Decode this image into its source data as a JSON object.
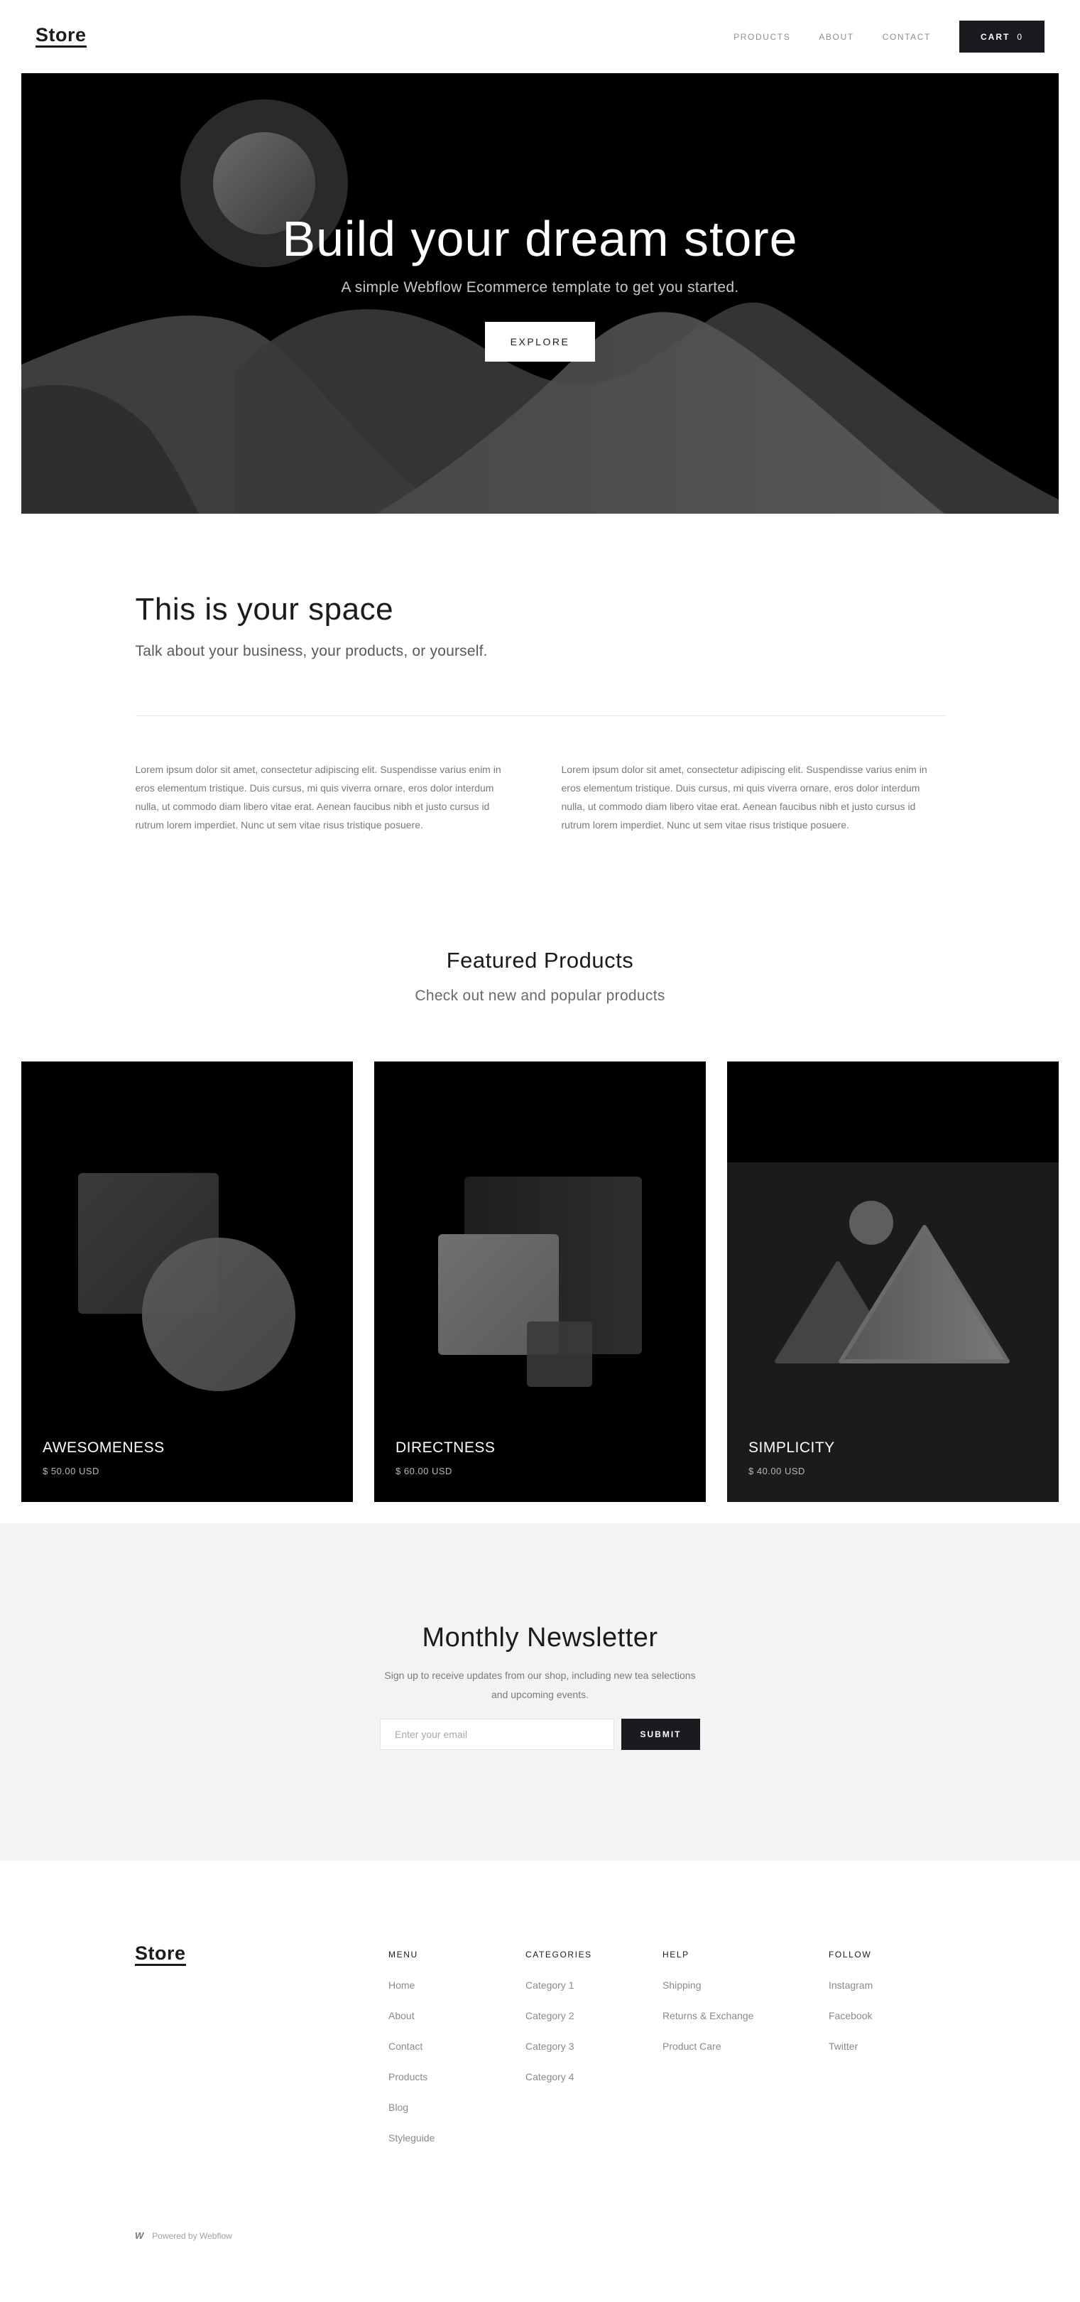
{
  "nav": {
    "brand": "Store",
    "links": [
      "PRODUCTS",
      "ABOUT",
      "CONTACT"
    ],
    "cart_label": "CART",
    "cart_count": "0"
  },
  "hero": {
    "title": "Build your dream store",
    "subtitle": "A simple Webflow Ecommerce template to get you started.",
    "button": "EXPLORE"
  },
  "space": {
    "title": "This is your space",
    "subtitle": "Talk about your business, your products, or yourself.",
    "paragraphs": [
      "Lorem ipsum dolor sit amet, consectetur adipiscing elit. Suspendisse varius enim in eros elementum tristique. Duis cursus, mi quis viverra ornare, eros dolor interdum nulla, ut commodo diam libero vitae erat. Aenean faucibus nibh et justo cursus id rutrum lorem imperdiet. Nunc ut sem vitae risus tristique posuere.",
      "Lorem ipsum dolor sit amet, consectetur adipiscing elit. Suspendisse varius enim in eros elementum tristique. Duis cursus, mi quis viverra ornare, eros dolor interdum nulla, ut commodo diam libero vitae erat. Aenean faucibus nibh et justo cursus id rutrum lorem imperdiet. Nunc ut sem vitae risus tristique posuere."
    ]
  },
  "featured": {
    "title": "Featured Products",
    "subtitle": "Check out new and popular products",
    "products": [
      {
        "name": "AWESOMENESS",
        "price": "$ 50.00 USD"
      },
      {
        "name": "DIRECTNESS",
        "price": "$ 60.00 USD"
      },
      {
        "name": "SIMPLICITY",
        "price": "$ 40.00 USD"
      }
    ]
  },
  "newsletter": {
    "title": "Monthly Newsletter",
    "text": "Sign up to receive updates from our shop, including new tea selections and upcoming events.",
    "placeholder": "Enter your email",
    "button": "SUBMIT"
  },
  "footer": {
    "brand": "Store",
    "columns": [
      {
        "heading": "MENU",
        "links": [
          "Home",
          "About",
          "Contact",
          "Products",
          "Blog",
          "Styleguide"
        ]
      },
      {
        "heading": "CATEGORIES",
        "links": [
          "Category 1",
          "Category 2",
          "Category 3",
          "Category 4"
        ]
      },
      {
        "heading": "HELP",
        "links": [
          "Shipping",
          "Returns & Exchange",
          "Product Care"
        ]
      },
      {
        "heading": "FOLLOW",
        "links": [
          "Instagram",
          "Facebook",
          "Twitter"
        ]
      }
    ],
    "powered_icon": "W",
    "powered_text": "Powered by Webflow"
  },
  "colors": {
    "dark": "#1a1b1f",
    "newsletter_bg": "#f3f3f3",
    "muted_text": "#8a8a8a"
  }
}
